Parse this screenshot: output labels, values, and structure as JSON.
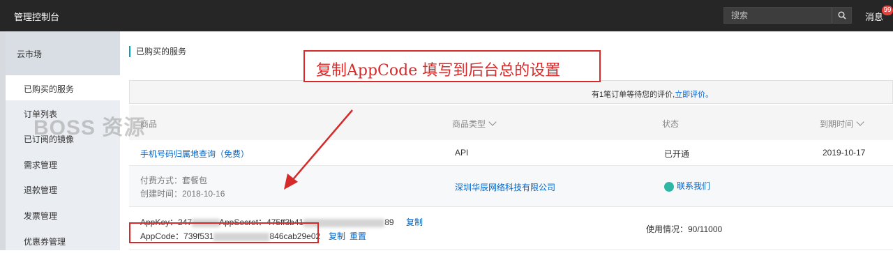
{
  "topbar": {
    "title": "管理控制台",
    "search_placeholder": "搜索",
    "messages_label": "消息",
    "messages_badge": "99"
  },
  "sidebar": {
    "header": "云市场",
    "items": [
      {
        "label": "已购买的服务",
        "active": true
      },
      {
        "label": "订单列表"
      },
      {
        "label": "已订阅的镜像"
      },
      {
        "label": "需求管理"
      },
      {
        "label": "退款管理"
      },
      {
        "label": "发票管理"
      },
      {
        "label": "优惠券管理"
      }
    ]
  },
  "watermark": "BOSS 资源",
  "page": {
    "title": "已购买的服务",
    "notice_text": "有1笔订单等待您的评价,",
    "notice_link": "立即评价。"
  },
  "table": {
    "columns": [
      "商品",
      "商品类型",
      "状态",
      "到期时间"
    ],
    "product_name": "手机号码归属地查询（免费）",
    "product_type": "API",
    "status": "已开通",
    "expiry": "2019-10-17",
    "payment_label": "付费方式：套餐包",
    "created_label": "创建时间：2018-10-16",
    "vendor": "深圳华辰网络科技有限公司",
    "contact": "联系我们",
    "appkey_label": "AppKey：247",
    "appsecret_label": "AppSecret：475ff3b41",
    "appsecret_tail": "89",
    "copy_label": "复制",
    "appcode_label": "AppCode：739f531",
    "appcode_tail": "846cab29e02",
    "copy_label2": "复制",
    "reset_label": "重置",
    "usage": "使用情况：90/11000"
  },
  "annotation": "复制AppCode 填写到后台总的设置",
  "colors": {
    "topbar": "#262626",
    "sidebar": "#eaedf1",
    "link": "#0066cc",
    "annotation_red": "#d62a2a",
    "accent": "#00a2ca"
  }
}
